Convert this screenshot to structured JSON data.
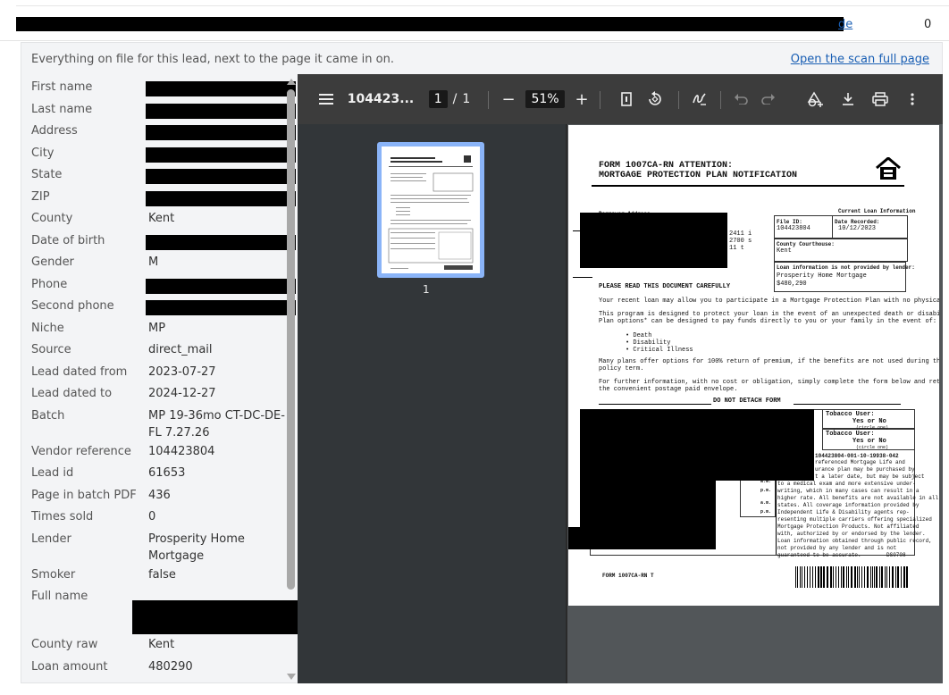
{
  "top": {
    "link_suffix": "de",
    "count": "0"
  },
  "panel": {
    "description": "Everything on file for this lead, next to the page it came in on.",
    "open_link": "Open the scan full page"
  },
  "fields": [
    {
      "key": "First name",
      "value": "",
      "redacted": true
    },
    {
      "key": "Last name",
      "value": "",
      "redacted": true
    },
    {
      "key": "Address",
      "value": "",
      "redacted": true
    },
    {
      "key": "City",
      "value": "",
      "redacted": true
    },
    {
      "key": "State",
      "value": "",
      "redacted": true
    },
    {
      "key": "ZIP",
      "value": "",
      "redacted": true
    },
    {
      "key": "County",
      "value": "Kent"
    },
    {
      "key": "Date of birth",
      "value": "",
      "redacted": true
    },
    {
      "key": "Gender",
      "value": "M"
    },
    {
      "key": "Phone",
      "value": "",
      "redacted": true
    },
    {
      "key": "Second phone",
      "value": "",
      "redacted": true
    },
    {
      "key": "Niche",
      "value": "MP"
    },
    {
      "key": "Source",
      "value": "direct_mail"
    },
    {
      "key": "Lead dated from",
      "value": "2023-07-27"
    },
    {
      "key": "Lead dated to",
      "value": "2024-12-27"
    },
    {
      "key": "Batch",
      "value": "MP 19-36mo CT-DC-DE-FL 7.27.26"
    },
    {
      "key": "Vendor reference",
      "value": "104423804"
    },
    {
      "key": "Lead id",
      "value": "61653"
    },
    {
      "key": "Page in batch PDF",
      "value": "436"
    },
    {
      "key": "Times sold",
      "value": "0"
    },
    {
      "key": "Lender",
      "value": "Prosperity Home Mortgage"
    },
    {
      "key": "Smoker",
      "value": "false"
    },
    {
      "key": "Full name",
      "value": "",
      "redacted": true,
      "big": true
    },
    {
      "key": "County raw",
      "value": "Kent"
    },
    {
      "key": "Loan amount",
      "value": "480290"
    }
  ],
  "viewer": {
    "filename": "104423...",
    "page_current": "1",
    "page_sep": "/",
    "page_total": "1",
    "zoom": "51%",
    "thumb_label": "1"
  },
  "doc": {
    "title1": "FORM 1007CA-RN ATTENTION:",
    "title2": "MORTGAGE PROTECTION PLAN NOTIFICATION",
    "borrower_label": "Borrower Address",
    "current_loan": "Current Loan Information",
    "file_id_label": "File ID:",
    "file_id": "104423804",
    "date_rec_label": "Date Recorded:",
    "date_rec": "10/12/2023",
    "courthouse_label": "County Courthouse:",
    "courthouse": "Kent",
    "lender_note": "Loan information is not provided by lender:",
    "lender": "Prosperity Home Mortgage",
    "amount": "$480,290",
    "addr1": "2411 i",
    "addr2": "2700 s",
    "addr3": "11 t",
    "read_carefully": "PLEASE READ THIS DOCUMENT CAREFULLY",
    "p1": "Your recent loan may allow you to participate in a Mortgage Protection Plan with no physical exam.",
    "p2a": "This program is designed to protect your loan in the event of an unexpected death or disability.",
    "p2b": "Plan options* can be designed to pay funds directly to you or your family in the event of:",
    "b1": "Death",
    "b2": "Disability",
    "b3": "Critical Illness",
    "p3a": "Many plans offer options for 100% return of premium, if the benefits are not used during the",
    "p3b": "policy term.",
    "p4a": "For further information, with no cost or obligation, simply complete the form below and return it in",
    "p4b": "the convenient postage paid envelope.",
    "detach": "DO NOT DETACH FORM",
    "tobacco1": "Tobacco User:",
    "tobacco1b": "Yes or No",
    "circle": "(circle one)",
    "tobacco2": "Tobacco User:",
    "tobacco2b": "Yes or No",
    "code": "104423804-001-10-19938-042",
    "am1": "a.m.",
    "pm1": "p.m.",
    "am2": "a.m.",
    "pm2": "p.m.",
    "fine1": "referenced Mortgage Life and",
    "fine2": "urance plan may be purchased by",
    "fine3": "t a later date, but may be subject",
    "fine4": "to a medical exam and more extensive under-",
    "fine5": "writing, which in many cases can result in a",
    "fine6": "higher rate.  All benefits are not available in all",
    "fine7": "states.  All coverage information provided by",
    "fine8": "Independent Life & Disability agents rep-",
    "fine9": "resenting multiple carriers offering specialized",
    "fine10": "Mortgage Protection Products.  Not affiliated",
    "fine11": "with, authorized by or endorsed by the lender.",
    "fine12": "Loan information obtained through public record,",
    "fine13": "not provided by any lender and is not",
    "fine14": "guaranteed to be accurate.",
    "ds": "DS0708",
    "footer": "FORM 1007CA-RN T"
  }
}
